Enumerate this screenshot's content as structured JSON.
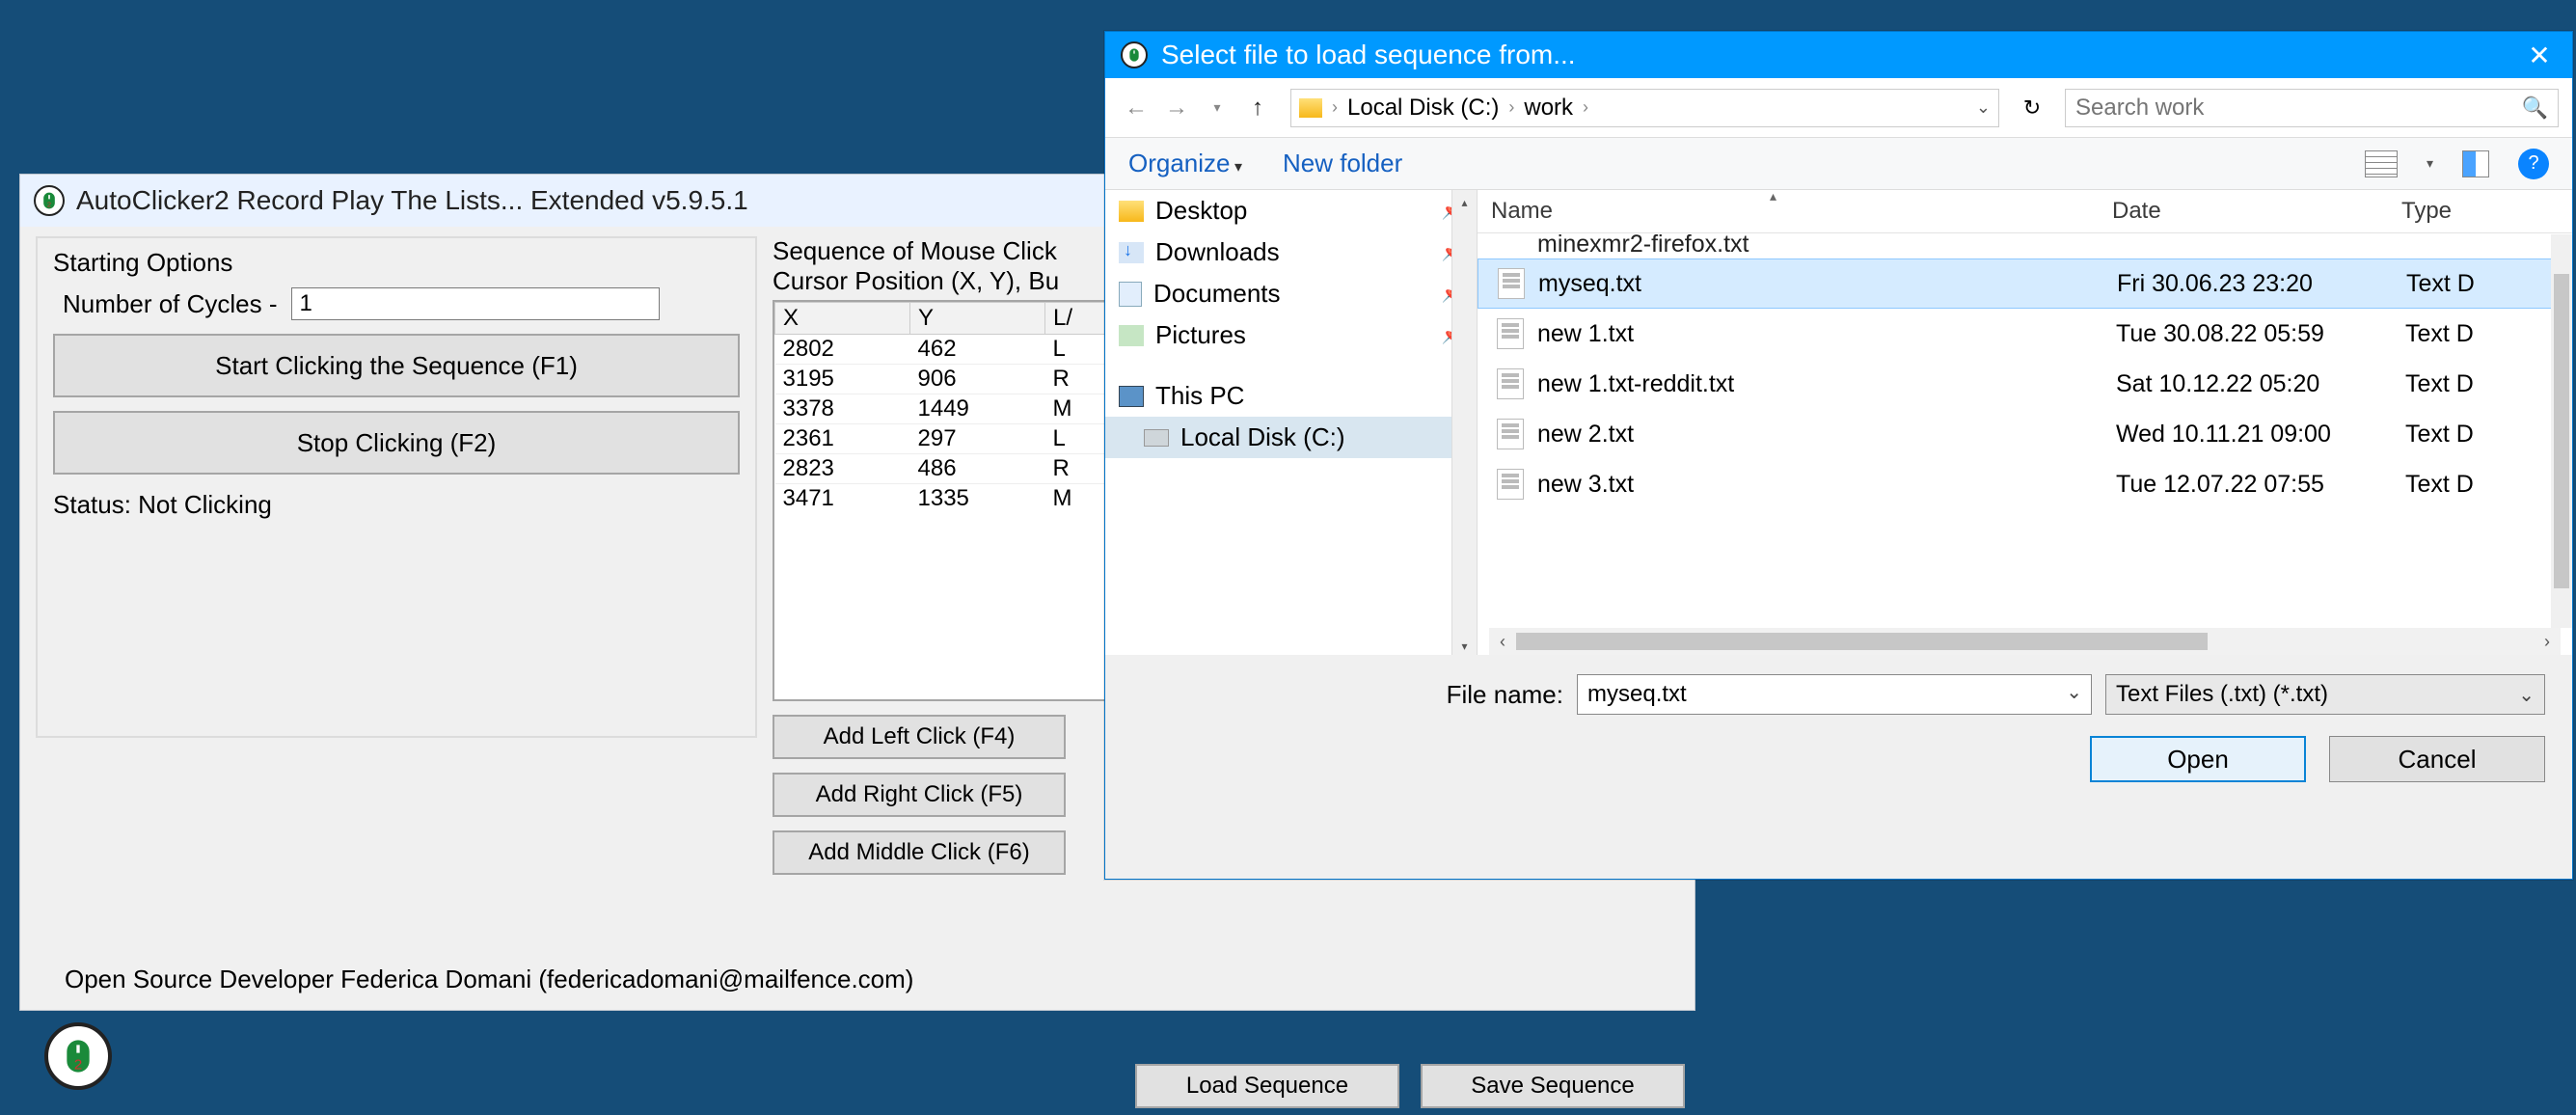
{
  "app": {
    "title": "AutoClicker2 Record Play The Lists... Extended v5.9.5.1",
    "footer": "Open Source Developer Federica Domani (federicadomani@mailfence.com)"
  },
  "start": {
    "group_title": "Starting Options",
    "cycles_label": "Number of Cycles -",
    "cycles_value": "1",
    "start_btn": "Start Clicking the Sequence (F1)",
    "stop_btn": "Stop Clicking (F2)",
    "status": "Status: Not Clicking"
  },
  "seq": {
    "title": "Sequence of Mouse Click",
    "sub": "Cursor Position (X, Y), Bu",
    "cols": {
      "x": "X",
      "y": "Y",
      "btn": "L/"
    },
    "rows": [
      {
        "x": "2802",
        "y": "462",
        "b": "L"
      },
      {
        "x": "3195",
        "y": "906",
        "b": "R"
      },
      {
        "x": "3378",
        "y": "1449",
        "b": "M"
      },
      {
        "x": "2361",
        "y": "297",
        "b": "L"
      },
      {
        "x": "2823",
        "y": "486",
        "b": "R"
      },
      {
        "x": "3471",
        "y": "1335",
        "b": "M"
      }
    ],
    "add_left": "Add Left Click (F4)",
    "add_right": "Add Right Click (F5)",
    "add_middle": "Add Middle Click (F6)",
    "load": "Load Sequence",
    "save": "Save Sequence"
  },
  "dialog": {
    "title": "Select file to load sequence from...",
    "breadcrumb": {
      "a": "Local Disk (C:)",
      "b": "work"
    },
    "search_placeholder": "Search work",
    "toolbar": {
      "organize": "Organize",
      "new_folder": "New folder"
    },
    "tree": {
      "desktop": "Desktop",
      "downloads": "Downloads",
      "documents": "Documents",
      "pictures": "Pictures",
      "this_pc": "This PC",
      "local_disk": "Local Disk (C:)"
    },
    "headers": {
      "name": "Name",
      "date": "Date",
      "type": "Type"
    },
    "partial_top": "minexmr2-firefox.txt",
    "files": [
      {
        "name": "myseq.txt",
        "date": "Fri 30.06.23 23:20",
        "type": "Text D",
        "selected": true
      },
      {
        "name": "new 1.txt",
        "date": "Tue 30.08.22 05:59",
        "type": "Text D"
      },
      {
        "name": "new 1.txt-reddit.txt",
        "date": "Sat 10.12.22 05:20",
        "type": "Text D"
      },
      {
        "name": "new 2.txt",
        "date": "Wed 10.11.21 09:00",
        "type": "Text D"
      },
      {
        "name": "new 3.txt",
        "date": "Tue 12.07.22 07:55",
        "type": "Text D"
      }
    ],
    "filename_label": "File name:",
    "filename_value": "myseq.txt",
    "filetype": "Text Files (.txt) (*.txt)",
    "open": "Open",
    "cancel": "Cancel"
  }
}
